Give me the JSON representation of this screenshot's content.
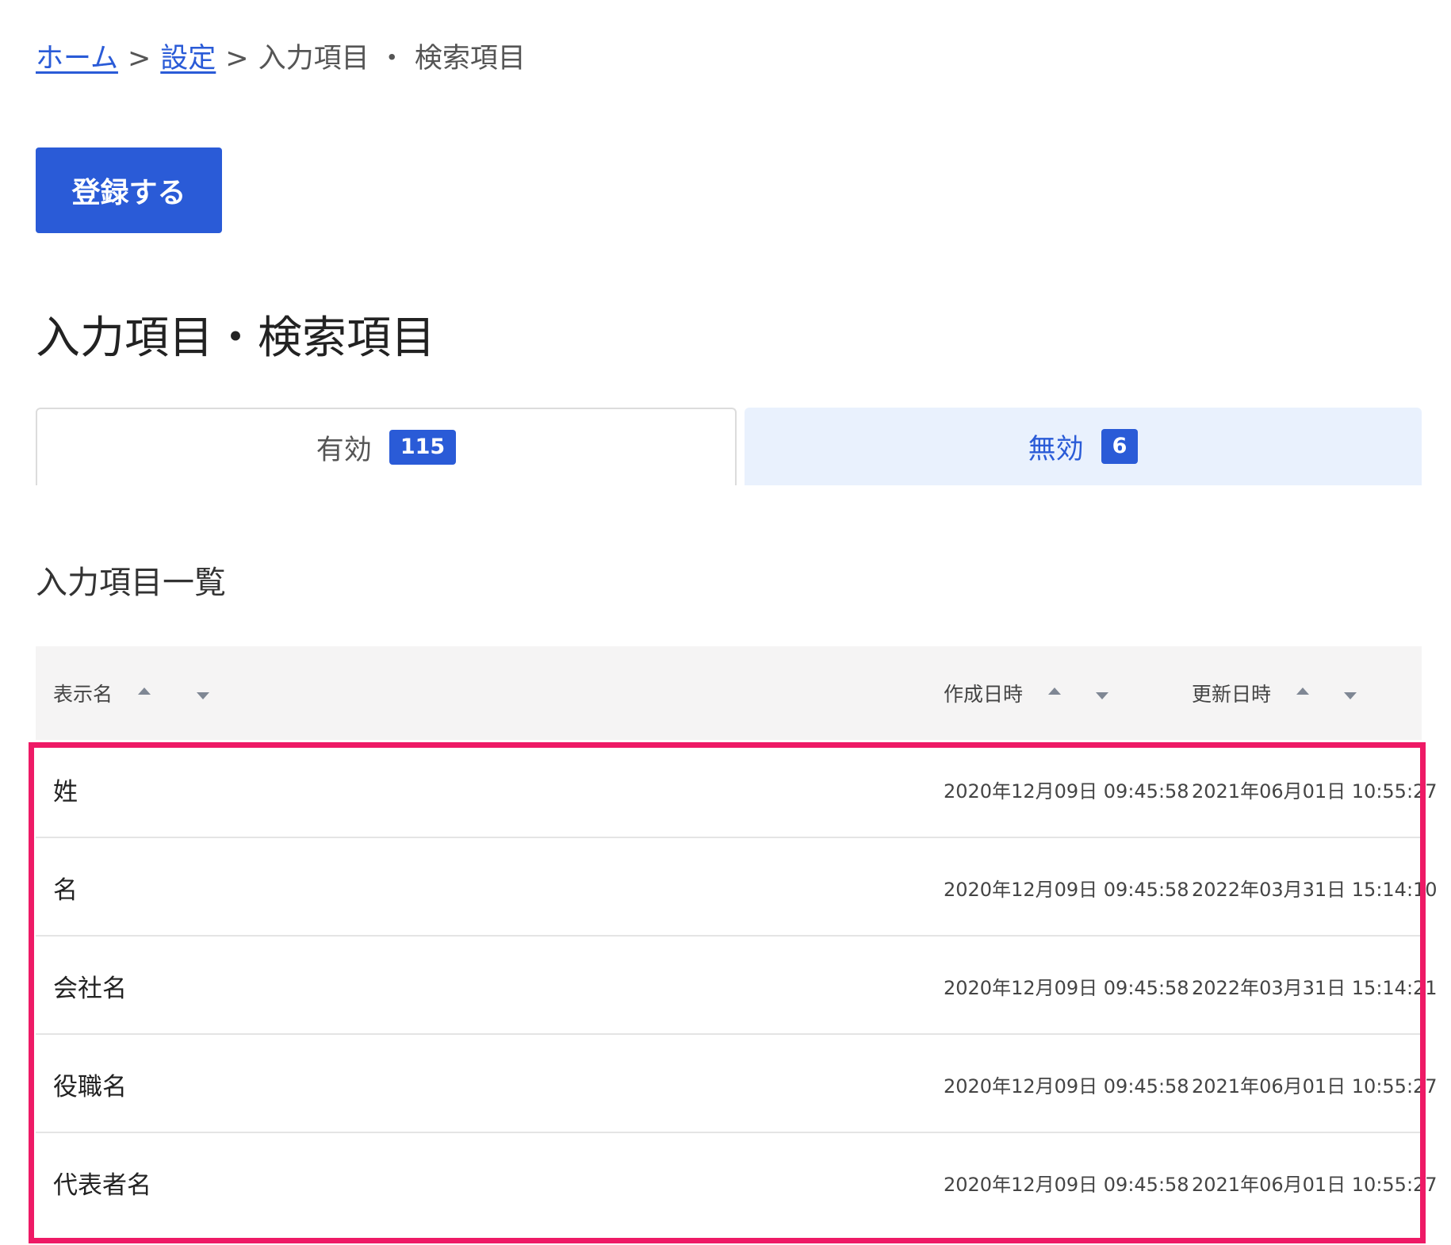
{
  "breadcrumb": {
    "home": "ホーム",
    "separator": ">",
    "settings": "設定",
    "current": "入力項目 ・ 検索項目"
  },
  "register_button": {
    "label": "登録する"
  },
  "page_title": "入力項目・検索項目",
  "tabs": [
    {
      "label": "有効",
      "count": "115",
      "active": true
    },
    {
      "label": "無効",
      "count": "6",
      "active": false
    }
  ],
  "section_heading": "入力項目一覧",
  "table": {
    "columns": [
      "表示名",
      "作成日時",
      "更新日時"
    ],
    "rows": [
      {
        "name": "姓",
        "created": "2020年12月09日 09:45:58",
        "updated": "2021年06月01日 10:55:27"
      },
      {
        "name": "名",
        "created": "2020年12月09日 09:45:58",
        "updated": "2022年03月31日 15:14:10"
      },
      {
        "name": "会社名",
        "created": "2020年12月09日 09:45:58",
        "updated": "2022年03月31日 15:14:21"
      },
      {
        "name": "役職名",
        "created": "2020年12月09日 09:45:58",
        "updated": "2021年06月01日 10:55:27"
      },
      {
        "name": "代表者名",
        "created": "2020年12月09日 09:45:58",
        "updated": "2021年06月01日 10:55:27"
      }
    ]
  },
  "colors": {
    "primary": "#2a5bd7",
    "inactive_tab_bg": "#e9f1fd",
    "table_header_bg": "#f5f4f4",
    "highlight": "#ee1a66"
  }
}
